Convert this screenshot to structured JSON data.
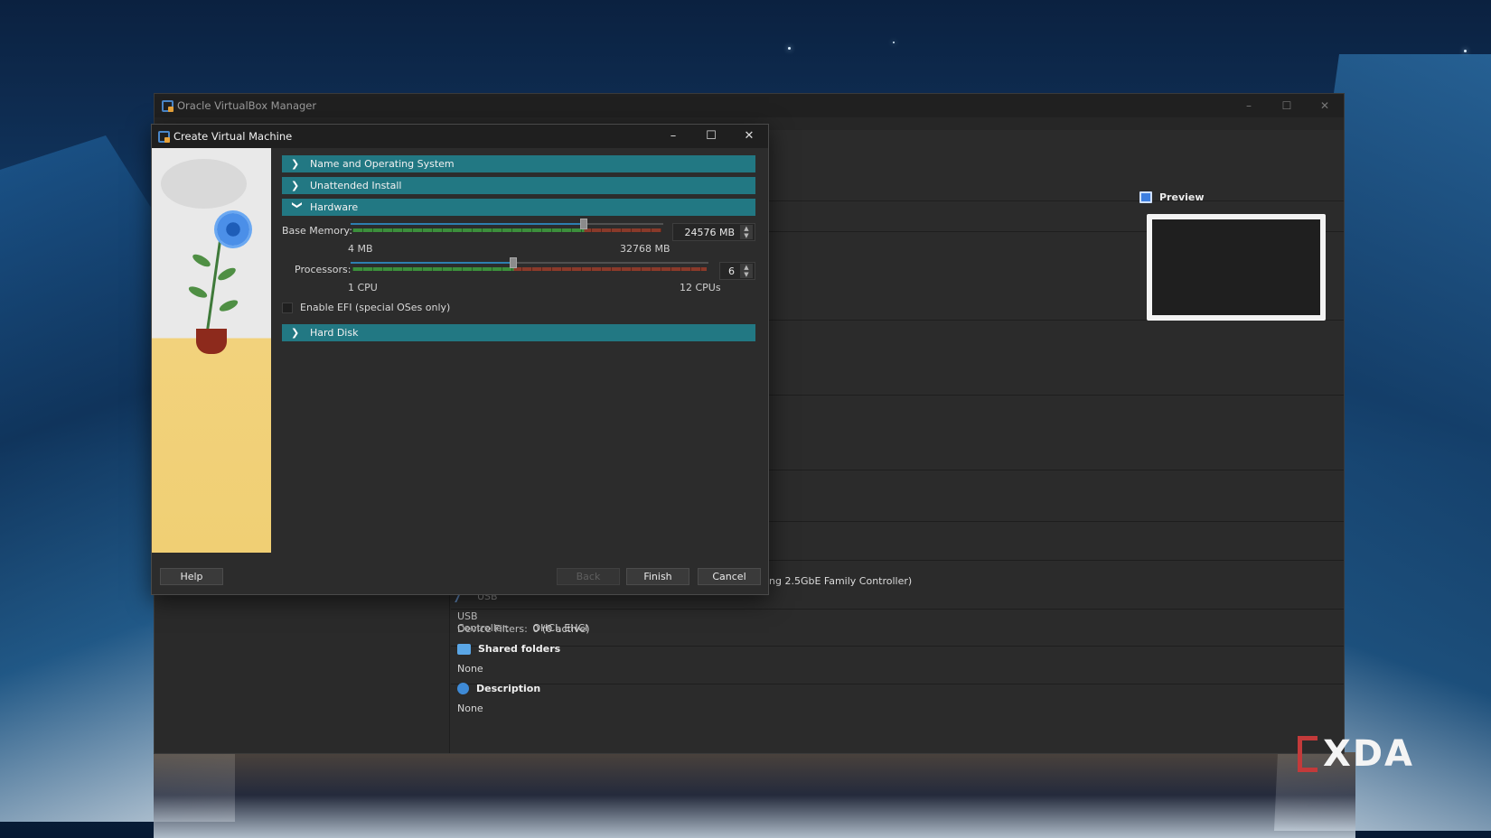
{
  "manager": {
    "title": "Oracle VirtualBox Manager",
    "controls": {
      "minimize": "–",
      "maximize": "☐",
      "close": "✕"
    },
    "preview_label": "Preview",
    "network_fragment": "ng 2.5GbE Family Controller)",
    "usb": {
      "label": "USB",
      "controller_key": "USB Controller:",
      "controller_val": "OHCI, EHCI",
      "filters_key": "Device Filters:",
      "filters_val": "0 (0 active)"
    },
    "shared_folders": {
      "label": "Shared folders",
      "value": "None"
    },
    "description": {
      "label": "Description",
      "value": "None"
    }
  },
  "dialog": {
    "title": "Create Virtual Machine",
    "controls": {
      "minimize": "–",
      "maximize": "☐",
      "close": "✕"
    },
    "sections": {
      "name_os": "Name and Operating System",
      "unattended": "Unattended Install",
      "hardware": "Hardware",
      "hard_disk": "Hard Disk"
    },
    "base_memory": {
      "label": "Base Memory:",
      "value": "24576 MB",
      "min_label": "4 MB",
      "max_label": "32768 MB",
      "level": 0.75
    },
    "processors": {
      "label": "Processors:",
      "value": "6",
      "min_label": "1 CPU",
      "max_label": "12 CPUs",
      "level": 0.4545
    },
    "efi": {
      "label": "Enable EFI (special OSes only)",
      "checked": false
    },
    "buttons": {
      "help": "Help",
      "back": "Back",
      "finish": "Finish",
      "cancel": "Cancel"
    }
  },
  "watermark": {
    "text": "XDA"
  },
  "colors": {
    "section_bar": "#227883",
    "slider_green": "#3c8f3c",
    "slider_red": "#8a3a2a",
    "accent_blue": "#2d7fb0"
  }
}
